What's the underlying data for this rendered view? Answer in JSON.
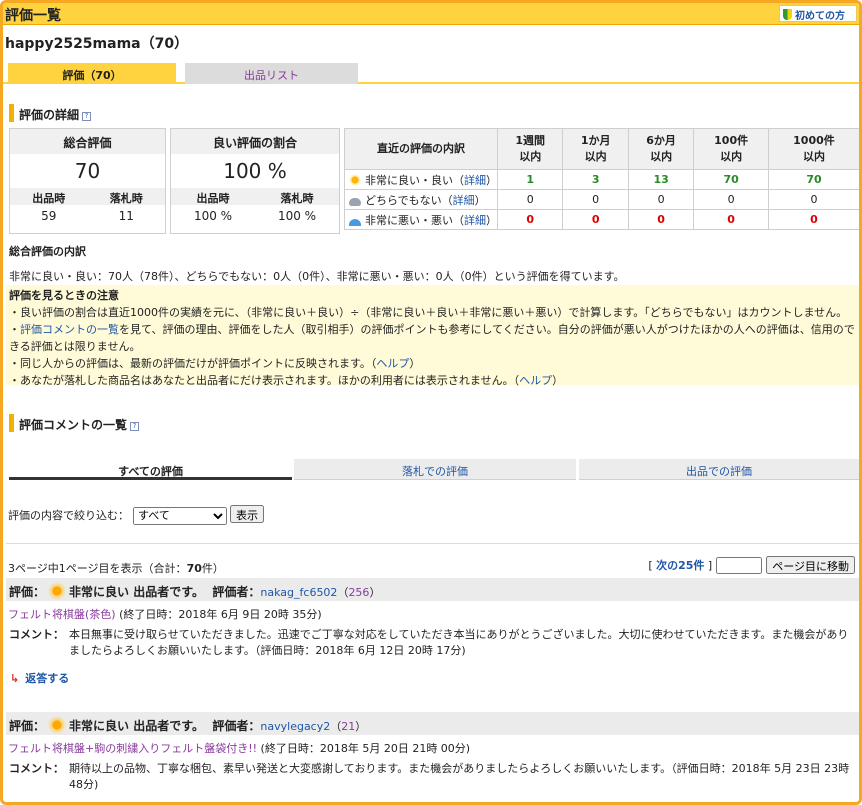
{
  "header": {
    "title": "評価一覧",
    "beginner": "初めての方"
  },
  "user": {
    "name": "happy2525mama（70）"
  },
  "tabs": {
    "ratings": "評価（70）",
    "listings": "出品リスト"
  },
  "details": {
    "title": "評価の詳細",
    "total": {
      "title": "総合評価",
      "value": "70",
      "seller_label": "出品時",
      "winner_label": "落札時",
      "seller": "59",
      "winner": "11"
    },
    "ratio": {
      "title": "良い評価の割合",
      "value": "100 %",
      "seller_label": "出品時",
      "winner_label": "落札時",
      "seller": "100 %",
      "winner": "100 %"
    },
    "recent": {
      "title": "直近の評価の内訳",
      "cols": [
        [
          "1週間",
          "以内"
        ],
        [
          "1か月",
          "以内"
        ],
        [
          "6か月",
          "以内"
        ],
        [
          "100件",
          "以内"
        ],
        [
          "1000件",
          "以内"
        ]
      ],
      "rows": [
        {
          "label": "非常に良い・良い",
          "detail": "詳細",
          "values": [
            "1",
            "3",
            "13",
            "70",
            "70"
          ]
        },
        {
          "label": "どちらでもない",
          "detail": "詳細",
          "values": [
            "0",
            "0",
            "0",
            "0",
            "0"
          ]
        },
        {
          "label": "非常に悪い・悪い",
          "detail": "詳細",
          "values": [
            "0",
            "0",
            "0",
            "0",
            "0"
          ]
        }
      ]
    }
  },
  "summary": {
    "title": "総合評価の内訳",
    "text": "非常に良い・良い：70人（78件）、どちらでもない：0人（0件）、非常に悪い・悪い：0人（0件）という評価を得ています。"
  },
  "notes": {
    "title": "評価を見るときの注意",
    "line1": "・良い評価の割合は直近1000件の実績を元に、（非常に良い＋良い）÷（非常に良い＋良い＋非常に悪い＋悪い）で計算します。「どちらでもない」はカウントしません。",
    "line2_link": "評価コメントの一覧",
    "line2_text": "を見て、評価の理由、評価をした人（取引相手）の評価ポイントも参考にしてください。自分の評価が悪い人がつけたほかの人への評価は、信用のできる評価とは限りません。",
    "line3": "・同じ人からの評価は、最新の評価だけが評価ポイントに反映されます。（",
    "line4": "・あなたが落札した商品名はあなたと出品者にだけ表示されます。ほかの利用者には表示されません。（",
    "help": "ヘルプ"
  },
  "comments": {
    "title": "評価コメントの一覧",
    "tabs": [
      "すべての評価",
      "落札での評価",
      "出品での評価"
    ],
    "filter_label": "評価の内容で絞り込む：",
    "filter_value": "すべて",
    "filter_button": "表示",
    "pager": {
      "text_a": "3ページ中1ページ目を表示（合計：",
      "total": "70",
      "text_b": "件）",
      "next": "次の25件",
      "goto_button": "ページ目に移動"
    }
  },
  "reviews": [
    {
      "label": "評価：",
      "rating": "非常に良い",
      "role": "出品者です。",
      "rater_label": "評価者：",
      "rater": "nakag_fc6502",
      "rater_score": "256",
      "item": "フェルト将棋盤(茶色)",
      "end": "(終了日時：2018年 6月 9日 20時 35分)",
      "comment_label": "コメント：",
      "comment": "本日無事に受け取らせていただきました。迅速でご丁寧な対応をしていただき本当にありがとうございました。大切に使わせていただきます。また機会がありましたらよろしくお願いいたします。（評価日時：2018年 6月 12日 20時 17分)",
      "reply": "返答する"
    },
    {
      "label": "評価：",
      "rating": "非常に良い",
      "role": "出品者です。",
      "rater_label": "評価者：",
      "rater": "navylegacy2",
      "rater_score": "21",
      "item": "フェルト将棋盤+駒の刺繍入りフェルト盤袋付き!!",
      "end": "(終了日時：2018年 5月 20日 21時 00分)",
      "comment_label": "コメント：",
      "comment": "期待以上の品物、丁寧な梱包、素早い発送と大変感謝しております。また機会がありましたらよろしくお願いいたします。（評価日時：2018年 5月 23日 23時 48分)"
    }
  ]
}
